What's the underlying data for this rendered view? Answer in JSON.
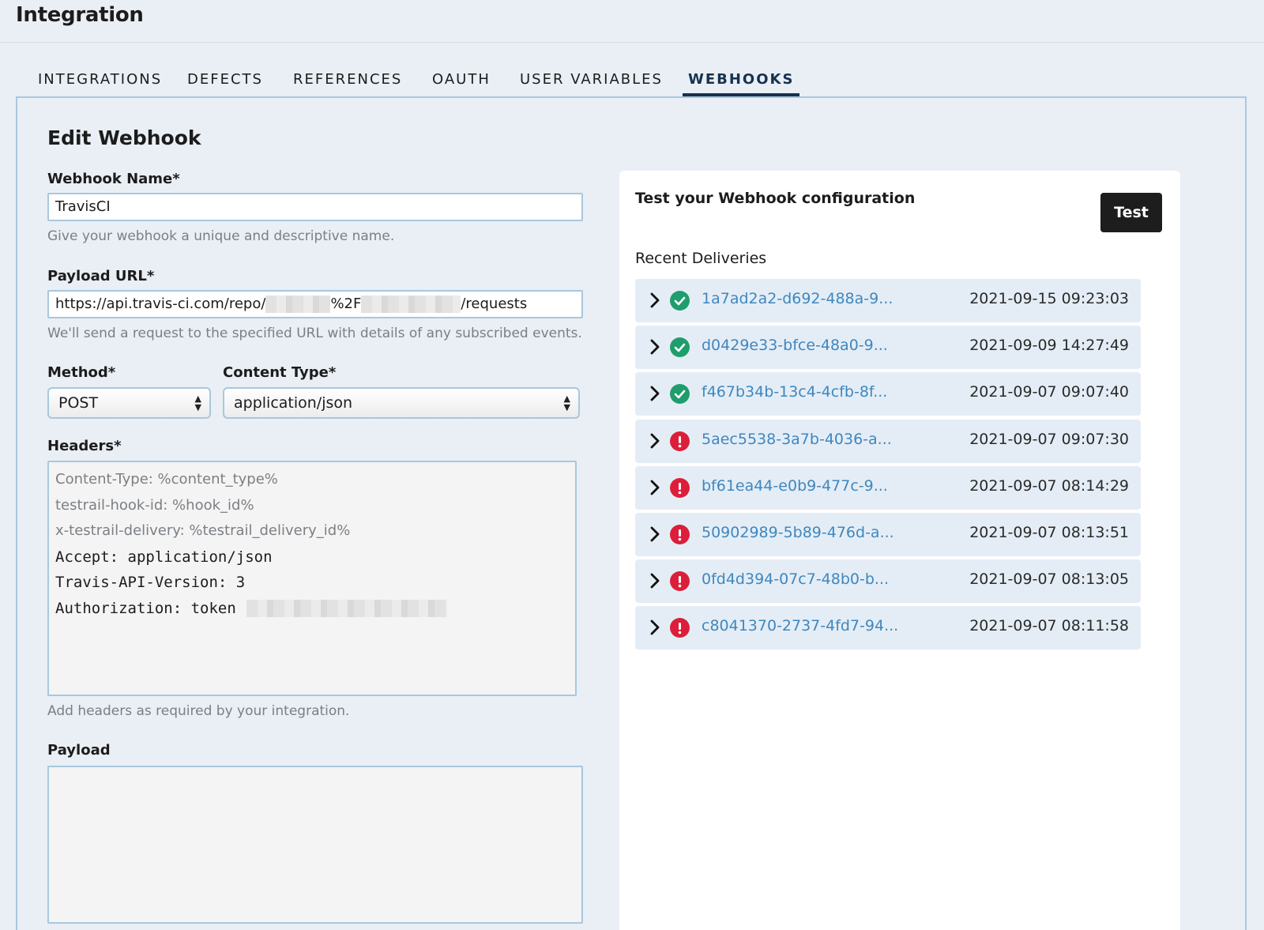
{
  "page": {
    "title": "Integration"
  },
  "tabs": [
    {
      "label": "INTEGRATIONS"
    },
    {
      "label": "DEFECTS"
    },
    {
      "label": "REFERENCES"
    },
    {
      "label": "OAUTH"
    },
    {
      "label": "USER VARIABLES"
    },
    {
      "label": "WEBHOOKS",
      "active": true
    }
  ],
  "form": {
    "title": "Edit Webhook",
    "name": {
      "label": "Webhook Name*",
      "value": "TravisCI",
      "hint": "Give your webhook a unique and descriptive name."
    },
    "url": {
      "label": "Payload URL*",
      "value_prefix": "https://api.travis-ci.com/repo/",
      "value_mid": "%2F",
      "value_suffix": "/requests",
      "hint": "We'll send a request to the specified URL with details of any subscribed events."
    },
    "method": {
      "label": "Method*",
      "value": "POST"
    },
    "content_type": {
      "label": "Content Type*",
      "value": "application/json"
    },
    "headers": {
      "label": "Headers*",
      "placeholder_lines": [
        "Content-Type: %content_type%",
        "testrail-hook-id: %hook_id%",
        "x-testrail-delivery: %testrail_delivery_id%"
      ],
      "lines": [
        "Accept: application/json",
        "Travis-API-Version: 3",
        "Authorization: token "
      ],
      "hint": "Add headers as required by your integration."
    },
    "payload": {
      "label": "Payload",
      "value": ""
    }
  },
  "test_panel": {
    "title": "Test your Webhook configuration",
    "button_label": "Test",
    "recent_label": "Recent Deliveries",
    "deliveries": [
      {
        "id": "1a7ad2a2-d692-488a-9...",
        "time": "2021-09-15 09:23:03",
        "status": "success"
      },
      {
        "id": "d0429e33-bfce-48a0-9...",
        "time": "2021-09-09 14:27:49",
        "status": "success"
      },
      {
        "id": "f467b34b-13c4-4cfb-8f...",
        "time": "2021-09-07 09:07:40",
        "status": "success"
      },
      {
        "id": "5aec5538-3a7b-4036-a...",
        "time": "2021-09-07 09:07:30",
        "status": "error"
      },
      {
        "id": "bf61ea44-e0b9-477c-9...",
        "time": "2021-09-07 08:14:29",
        "status": "error"
      },
      {
        "id": "50902989-5b89-476d-a...",
        "time": "2021-09-07 08:13:51",
        "status": "error"
      },
      {
        "id": "0fd4d394-07c7-48b0-b...",
        "time": "2021-09-07 08:13:05",
        "status": "error"
      },
      {
        "id": "c8041370-2737-4fd7-94...",
        "time": "2021-09-07 08:11:58",
        "status": "error"
      }
    ]
  },
  "colors": {
    "background": "#e9eff5",
    "border": "#a9c7dd",
    "link": "#3f87c0",
    "success": "#1f9d6c",
    "error": "#dc1e3a",
    "active_tab": "#17324f"
  }
}
